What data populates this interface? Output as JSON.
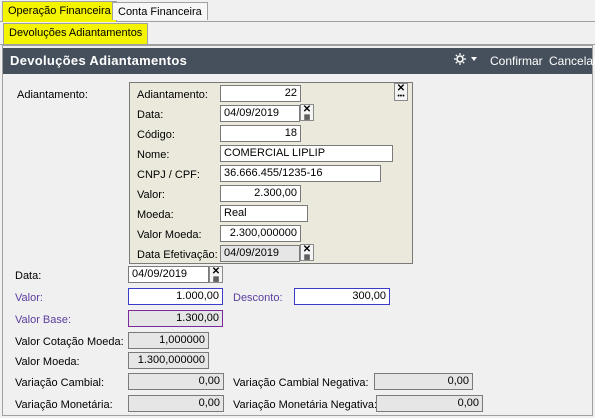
{
  "tabs": {
    "top": [
      "Operação Financeira",
      "Conta Financeira"
    ],
    "sub": [
      "Devoluções Adiantamentos"
    ]
  },
  "header": {
    "title": "Devoluções Adiantamentos",
    "confirm": "Confirmar",
    "cancel": "Cancelar"
  },
  "adiantamento": {
    "label": "Adiantamento:",
    "fields": {
      "adiantamento": {
        "label": "Adiantamento:",
        "value": "22"
      },
      "data": {
        "label": "Data:",
        "value": "04/09/2019"
      },
      "codigo": {
        "label": "Código:",
        "value": "18"
      },
      "nome": {
        "label": "Nome:",
        "value": "COMERCIAL LIPLIP"
      },
      "cnpj": {
        "label": "CNPJ / CPF:",
        "value": "36.666.455/1235-16"
      },
      "valor": {
        "label": "Valor:",
        "value": "2.300,00"
      },
      "moeda": {
        "label": "Moeda:",
        "value": "Real"
      },
      "valor_moeda": {
        "label": "Valor Moeda:",
        "value": "2.300,000000"
      },
      "data_efetivacao": {
        "label": "Data Efetivação:",
        "value": "04/09/2019"
      }
    }
  },
  "form": {
    "data": {
      "label": "Data:",
      "value": "04/09/2019"
    },
    "valor": {
      "label": "Valor:",
      "value": "1.000,00"
    },
    "desconto": {
      "label": "Desconto:",
      "value": "300,00"
    },
    "valor_base": {
      "label": "Valor Base:",
      "value": "1.300,00"
    },
    "valor_cotacao_moeda": {
      "label": "Valor Cotação Moeda:",
      "value": "1,000000"
    },
    "valor_moeda": {
      "label": "Valor Moeda:",
      "value": "1.300,000000"
    },
    "variacao_cambial": {
      "label": "Variação Cambial:",
      "value": "0,00"
    },
    "variacao_cambial_negativa": {
      "label": "Variação Cambial Negativa:",
      "value": "0,00"
    },
    "variacao_monetaria": {
      "label": "Variação Monetária:",
      "value": "0,00"
    },
    "variacao_monetaria_negativa": {
      "label": "Variação Monetária Negativa:",
      "value": "0,00"
    }
  },
  "colors": {
    "header_bg": "#45505c",
    "active_tab": "#f4f400",
    "group_bg": "#ebe9dc",
    "accent_label": "#5b3ea0"
  },
  "icons": {
    "header_tool": "gear-dropdown-icon",
    "clear_date": "clear-date-icon",
    "lookup": "lookup-icon"
  }
}
